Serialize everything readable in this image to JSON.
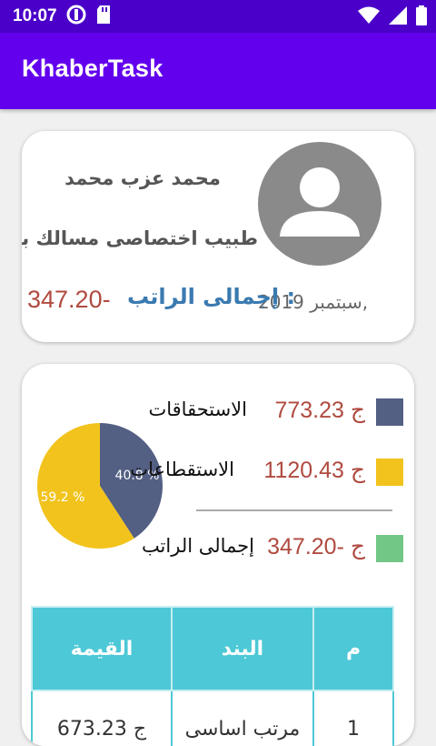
{
  "status_bar": {
    "time": "10:07",
    "left_icons": [
      "data-saver-icon",
      "sd-card-icon"
    ],
    "right_icons": [
      "wifi-icon",
      "signal-icon",
      "battery-icon"
    ]
  },
  "app_bar": {
    "title": "KhaberTask"
  },
  "employee": {
    "name": "محمد عزب محمد",
    "job_title": "طبيب اختصاصى مسالك بولية",
    "month": "سبتمبر,",
    "year": "2019",
    "net_salary_label": "إجمالى الراتب :",
    "net_salary_value": "347.20-"
  },
  "summary": {
    "chart_data": {
      "type": "pie",
      "slices": [
        {
          "value": 40.8,
          "label": "40.8 %",
          "color": "#535f83"
        },
        {
          "value": 59.2,
          "label": "59.2 %",
          "color": "#f2c31d"
        }
      ]
    },
    "legend": [
      {
        "label": "الاستحقاقات",
        "currency": "ج",
        "amount": "773.23",
        "color": "#535f83"
      },
      {
        "label": "الاستقطاعات",
        "currency": "ج",
        "amount": "1120.43",
        "color": "#f2c31d"
      },
      {
        "label": "إجمالى الراتب",
        "currency": "ج",
        "amount": "347.20-",
        "color": "#72c787"
      }
    ]
  },
  "table": {
    "headers": {
      "index": "م",
      "item": "البند",
      "value": "القيمة"
    },
    "rows": [
      {
        "index": "1",
        "item": "مرتب اساسى",
        "value": "673.23 ج"
      }
    ]
  }
}
